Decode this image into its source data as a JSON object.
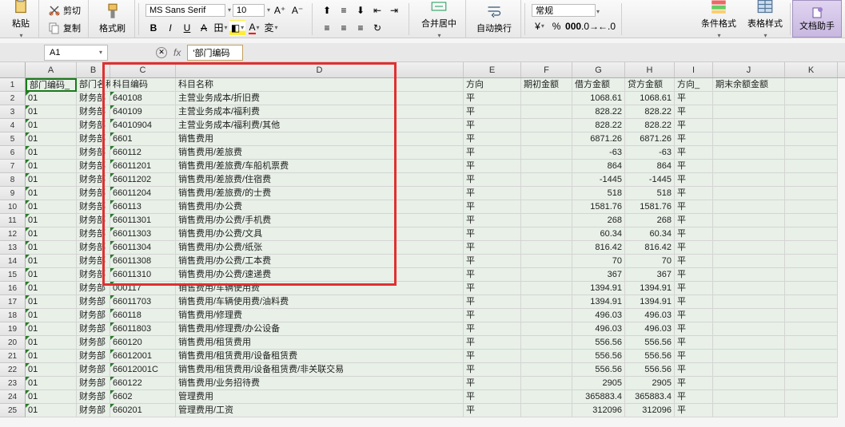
{
  "toolbar": {
    "paste": "粘贴",
    "cut": "剪切",
    "copy": "复制",
    "fmtpaint": "格式刷",
    "font_name": "MS Sans Serif",
    "font_size": "10",
    "mergectr": "合并居中",
    "wrap": "自动换行",
    "numfmt": "常规",
    "condfmt": "条件格式",
    "tblstyle": "表格样式",
    "assist": "文档助手"
  },
  "namebox": "A1",
  "formula": "'部门编码",
  "columns": [
    "A",
    "B",
    "C",
    "D",
    "E",
    "F",
    "G",
    "H",
    "I",
    "J",
    "K"
  ],
  "header_row": {
    "A": "部门编码_",
    "B": "部门名称",
    "C": "科目编码",
    "D": "科目名称",
    "E": "方向",
    "F": "期初金额",
    "G": "借方金额",
    "H": "贷方金额",
    "I": "方向_",
    "J": "期末余额金额"
  },
  "rows": [
    {
      "A": "01",
      "B": "财务部",
      "C": "640108",
      "D": "主营业务成本/折旧费",
      "E": "平",
      "G": "1068.61",
      "H": "1068.61",
      "I": "平"
    },
    {
      "A": "01",
      "B": "财务部",
      "C": "640109",
      "D": "主营业务成本/福利费",
      "E": "平",
      "G": "828.22",
      "H": "828.22",
      "I": "平"
    },
    {
      "A": "01",
      "B": "财务部",
      "C": "64010904",
      "D": "主营业务成本/福利费/其他",
      "E": "平",
      "G": "828.22",
      "H": "828.22",
      "I": "平"
    },
    {
      "A": "01",
      "B": "财务部",
      "C": "6601",
      "D": "销售费用",
      "E": "平",
      "G": "6871.26",
      "H": "6871.26",
      "I": "平"
    },
    {
      "A": "01",
      "B": "财务部",
      "C": "660112",
      "D": "销售费用/差旅费",
      "E": "平",
      "G": "-63",
      "H": "-63",
      "I": "平"
    },
    {
      "A": "01",
      "B": "财务部",
      "C": "66011201",
      "D": "销售费用/差旅费/车船机票费",
      "E": "平",
      "G": "864",
      "H": "864",
      "I": "平"
    },
    {
      "A": "01",
      "B": "财务部",
      "C": "66011202",
      "D": "销售费用/差旅费/住宿费",
      "E": "平",
      "G": "-1445",
      "H": "-1445",
      "I": "平"
    },
    {
      "A": "01",
      "B": "财务部",
      "C": "66011204",
      "D": "销售费用/差旅费/的士费",
      "E": "平",
      "G": "518",
      "H": "518",
      "I": "平"
    },
    {
      "A": "01",
      "B": "财务部",
      "C": "660113",
      "D": "销售费用/办公费",
      "E": "平",
      "G": "1581.76",
      "H": "1581.76",
      "I": "平"
    },
    {
      "A": "01",
      "B": "财务部",
      "C": "66011301",
      "D": "销售费用/办公费/手机费",
      "E": "平",
      "G": "268",
      "H": "268",
      "I": "平"
    },
    {
      "A": "01",
      "B": "财务部",
      "C": "66011303",
      "D": "销售费用/办公费/文具",
      "E": "平",
      "G": "60.34",
      "H": "60.34",
      "I": "平"
    },
    {
      "A": "01",
      "B": "财务部",
      "C": "66011304",
      "D": "销售费用/办公费/纸张",
      "E": "平",
      "G": "816.42",
      "H": "816.42",
      "I": "平"
    },
    {
      "A": "01",
      "B": "财务部",
      "C": "66011308",
      "D": "销售费用/办公费/工本费",
      "E": "平",
      "G": "70",
      "H": "70",
      "I": "平"
    },
    {
      "A": "01",
      "B": "财务部",
      "C": "66011310",
      "D": "销售费用/办公费/速递费",
      "E": "平",
      "G": "367",
      "H": "367",
      "I": "平"
    },
    {
      "A": "01",
      "B": "财务部",
      "C": "000117",
      "D": "销售费用/车辆使用费",
      "E": "平",
      "G": "1394.91",
      "H": "1394.91",
      "I": "平"
    },
    {
      "A": "01",
      "B": "财务部",
      "C": "66011703",
      "D": "销售费用/车辆使用费/油料费",
      "E": "平",
      "G": "1394.91",
      "H": "1394.91",
      "I": "平"
    },
    {
      "A": "01",
      "B": "财务部",
      "C": "660118",
      "D": "销售费用/修理费",
      "E": "平",
      "G": "496.03",
      "H": "496.03",
      "I": "平"
    },
    {
      "A": "01",
      "B": "财务部",
      "C": "66011803",
      "D": "销售费用/修理费/办公设备",
      "E": "平",
      "G": "496.03",
      "H": "496.03",
      "I": "平"
    },
    {
      "A": "01",
      "B": "财务部",
      "C": "660120",
      "D": "销售费用/租赁费用",
      "E": "平",
      "G": "556.56",
      "H": "556.56",
      "I": "平"
    },
    {
      "A": "01",
      "B": "财务部",
      "C": "66012001",
      "D": "销售费用/租赁费用/设备租赁费",
      "E": "平",
      "G": "556.56",
      "H": "556.56",
      "I": "平"
    },
    {
      "A": "01",
      "B": "财务部",
      "C": "66012001C",
      "D": "销售费用/租赁费用/设备租赁费/非关联交易",
      "E": "平",
      "G": "556.56",
      "H": "556.56",
      "I": "平"
    },
    {
      "A": "01",
      "B": "财务部",
      "C": "660122",
      "D": "销售费用/业务招待费",
      "E": "平",
      "G": "2905",
      "H": "2905",
      "I": "平"
    },
    {
      "A": "01",
      "B": "财务部",
      "C": "6602",
      "D": "管理费用",
      "E": "平",
      "G": "365883.4",
      "H": "365883.4",
      "I": "平"
    },
    {
      "A": "01",
      "B": "财务部",
      "C": "660201",
      "D": "管理费用/工资",
      "E": "平",
      "G": "312096",
      "H": "312096",
      "I": "平"
    }
  ]
}
